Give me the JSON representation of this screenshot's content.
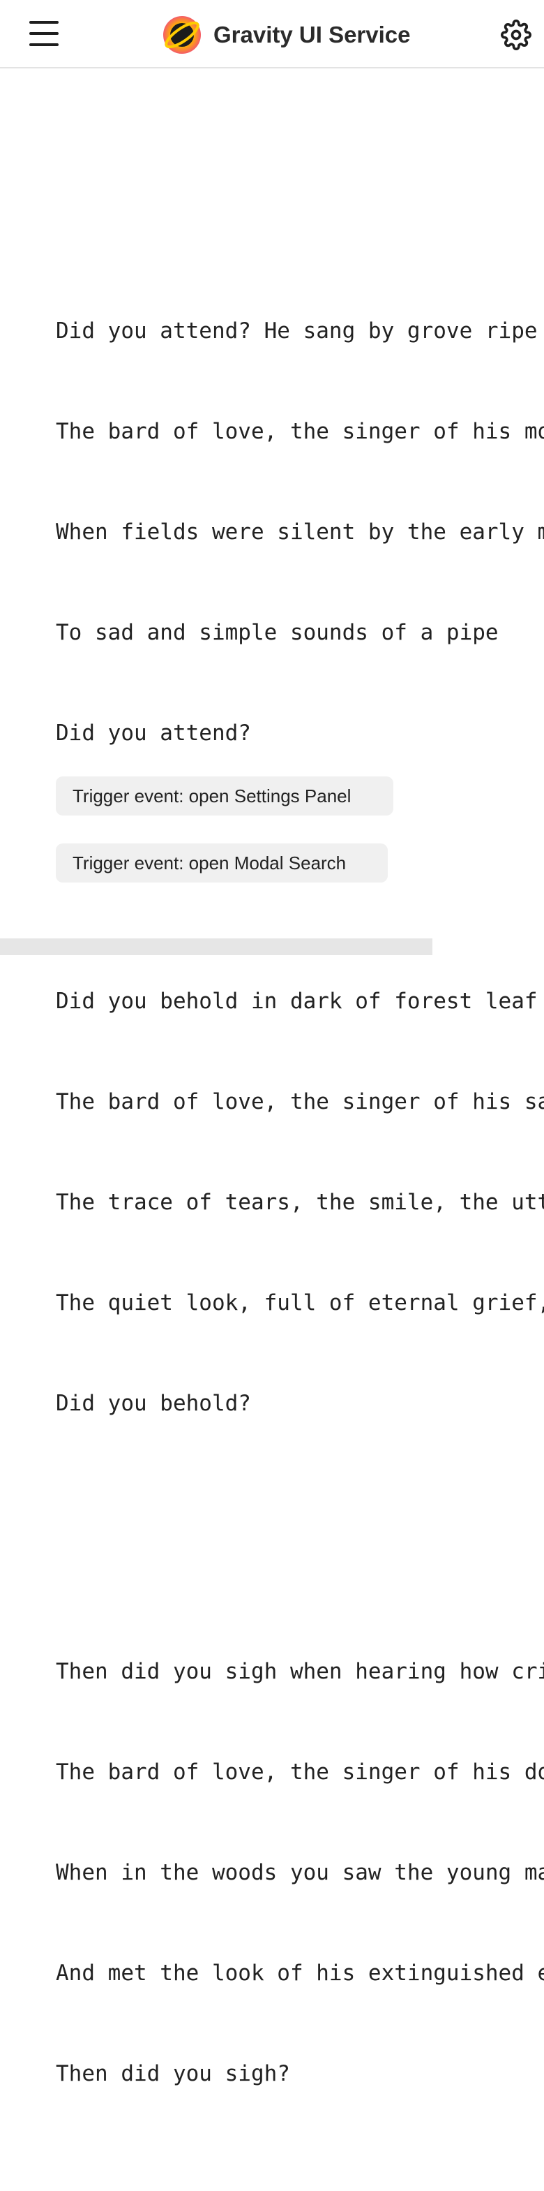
{
  "header": {
    "title": "Gravity UI Service",
    "menu_icon": "hamburger-menu-icon",
    "logo_icon": "planet-logo-icon",
    "settings_icon": "gear-icon"
  },
  "poem": {
    "stanzas": [
      [
        "Did you attend? He sang by grove ripe -",
        "The bard of love, the singer of his mou",
        "When fields were silent by the early mo",
        "To sad and simple sounds of a pipe",
        "Did you attend?"
      ],
      [
        "Did you behold in dark of forest leaf",
        "The bard of love, the singer of his sad",
        "The trace of tears, the smile, the utte",
        "The quiet look, full of eternal grief,",
        "Did you behold?"
      ],
      [
        "Then did you sigh when hearing how crie",
        "The bard of love, the singer of his dol",
        "When in the woods you saw the young man",
        "And met the look of his extinguished ey",
        "Then did you sigh?"
      ]
    ]
  },
  "actions": {
    "settings_panel_label": "Trigger event: open Settings Panel",
    "modal_search_label": "Trigger event: open Modal Search"
  },
  "colors": {
    "logo_outer": "#f45b69",
    "logo_inner": "#ffcc00",
    "text": "#222222",
    "button_bg": "#f0f0f0"
  }
}
